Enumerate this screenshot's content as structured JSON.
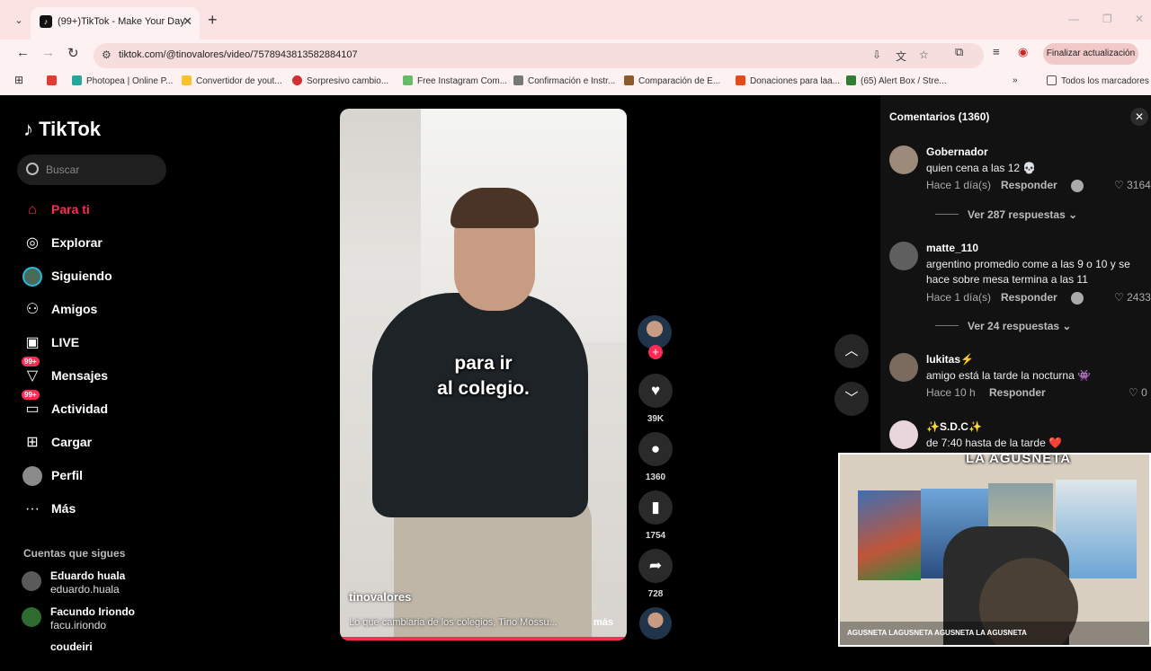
{
  "browser": {
    "tab_title": "(99+)TikTok - Make Your Day",
    "url": "tiktok.com/@tinovalores/video/7578943813582884107",
    "update_label": "Finalizar actualización",
    "bookmarks": [
      "Photopea | Online P...",
      "Convertidor de yout...",
      "Sorpresivo cambio...",
      "Free Instagram Com...",
      "Confirmación e Instr...",
      "Comparación de E...",
      "Donaciones para laa...",
      "(65) Alert Box / Stre..."
    ],
    "all_bookmarks": "Todos los marcadores"
  },
  "sidebar": {
    "logo": "TikTok",
    "search_placeholder": "Buscar",
    "items": [
      {
        "label": "Para ti",
        "active": true
      },
      {
        "label": "Explorar"
      },
      {
        "label": "Siguiendo"
      },
      {
        "label": "Amigos"
      },
      {
        "label": "LIVE"
      },
      {
        "label": "Mensajes",
        "badge": "99+"
      },
      {
        "label": "Actividad",
        "badge": "99+"
      },
      {
        "label": "Cargar"
      },
      {
        "label": "Perfil"
      },
      {
        "label": "Más"
      }
    ],
    "following_title": "Cuentas que sigues",
    "following": [
      {
        "name": "Eduardo huala",
        "handle": "eduardo.huala"
      },
      {
        "name": "Facundo Iriondo",
        "handle": "facu.iriondo"
      },
      {
        "name": "coudeiri",
        "handle": ""
      }
    ]
  },
  "video": {
    "subtitle_line1": "para ir",
    "subtitle_line2": "al colegio.",
    "author": "tinovalores",
    "description": "Lo que cambiaria de los colegios, Tino Mossu...",
    "more": "más"
  },
  "actions": {
    "likes": "39K",
    "comments": "1360",
    "saves": "1754",
    "shares": "728"
  },
  "comments": {
    "title": "Comentarios (1360)",
    "reply_label": "Responder",
    "list": [
      {
        "user": "Gobernador",
        "text": "quien cena a las 12 💀",
        "time": "Hace 1 día(s)",
        "likes": "3164",
        "replies": "Ver 287 respuestas"
      },
      {
        "user": "matte_110",
        "text": "argentino promedio come a las 9 o 10 y se hace sobre mesa termina a las 11",
        "time": "Hace 1 día(s)",
        "likes": "2433",
        "replies": "Ver 24 respuestas"
      },
      {
        "user": "lukitas⚡",
        "text": "amigo está la tarde la nocturna 👾",
        "time": "Hace 10 h",
        "likes": "0",
        "replies": ""
      },
      {
        "user": "✨S.D.C✨",
        "text": "de 7:40 hasta de la tarde ❤️",
        "time": "",
        "likes": "",
        "replies": ""
      }
    ]
  },
  "webcam": {
    "logo": "LA AGUSNETA",
    "socials": "AGUSNETA   LAGUSNETA   AGUSNETA   LA AGUSNETA"
  },
  "colors": {
    "accent": "#fe2c55",
    "background": "#000000",
    "panel": "#121212"
  }
}
